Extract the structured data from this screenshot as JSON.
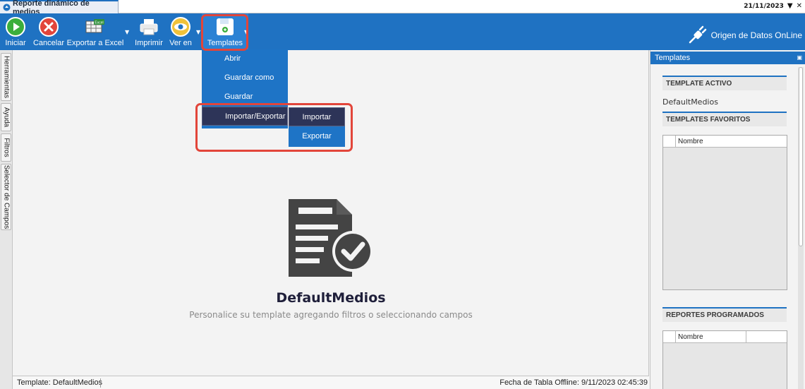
{
  "window": {
    "tab_title": "Reporte dinámico de medios",
    "date": "21/11/2023"
  },
  "toolbar": {
    "buttons": [
      {
        "label": "Iniciar",
        "icon": "play-icon"
      },
      {
        "label": "Cancelar",
        "icon": "cancel-icon"
      },
      {
        "label": "Exportar a Excel",
        "icon": "excel-icon",
        "badge": "Excel"
      },
      {
        "label": "Imprimir",
        "icon": "printer-icon"
      },
      {
        "label": "Ver en",
        "icon": "eye-icon"
      },
      {
        "label": "Templates",
        "icon": "floppy-icon"
      }
    ],
    "online_label": "Origen de Datos OnLine"
  },
  "templates_menu": {
    "items": [
      "Abrir",
      "Guardar como",
      "Guardar",
      "Importar/Exportar"
    ],
    "active": "Importar/Exportar",
    "submenu": [
      "Importar",
      "Exportar"
    ]
  },
  "left_tabs": [
    "Herramientas",
    "Ayuda",
    "Filtros",
    "Selector de Campos"
  ],
  "main": {
    "template_name": "DefaultMedios",
    "hint": "Personalice su template agregando filtros o seleccionando campos"
  },
  "right_panel": {
    "title": "Templates",
    "active_section": "TEMPLATE ACTIVO",
    "active_template": "DefaultMedios",
    "favorites_section": "TEMPLATES FAVORITOS",
    "favorites_column": "Nombre",
    "scheduled_section": "REPORTES PROGRAMADOS",
    "scheduled_column": "Nombre"
  },
  "status": {
    "left": "Template: DefaultMedios",
    "right": "Fecha de Tabla Offline: 9/11/2023 02:45:39"
  },
  "colors": {
    "ribbon": "#1f72c2",
    "menu": "#1e74c6",
    "menu_active": "#2d3458",
    "highlight": "#e2453a"
  }
}
